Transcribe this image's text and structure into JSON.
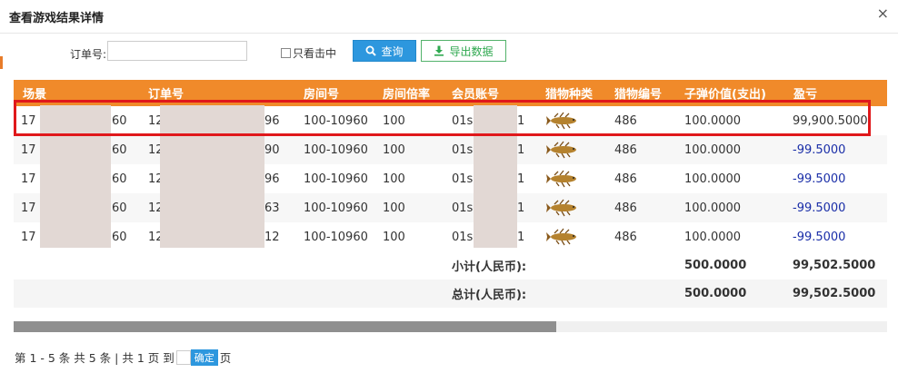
{
  "dialog": {
    "title": "查看游戏结果详情",
    "close": "×"
  },
  "toolbar": {
    "order_label": "订单号:",
    "order_value": "",
    "only_hit_label": "只看击中",
    "query_label": "查询",
    "export_label": "导出数据"
  },
  "table": {
    "headers": [
      "场景",
      "订单号",
      "房间号",
      "房间倍率",
      "会员账号",
      "猎物种类",
      "猎物编号",
      "子弹价值(支出)",
      "盈亏"
    ],
    "rows": [
      {
        "scene_a": "17",
        "scene_b": "60",
        "order_a": "12",
        "order_b": "96",
        "room": "100-10960",
        "rate": "100",
        "member_a": "01s",
        "member_b": "1",
        "prey_icon": "fish-icon",
        "prey_no": "486",
        "bullet": "100.0000",
        "profit": "99,900.5000"
      },
      {
        "scene_a": "17",
        "scene_b": "60",
        "order_a": "12",
        "order_b": "90",
        "room": "100-10960",
        "rate": "100",
        "member_a": "01s",
        "member_b": "1",
        "prey_icon": "fish-icon",
        "prey_no": "486",
        "bullet": "100.0000",
        "profit": "-99.5000"
      },
      {
        "scene_a": "17",
        "scene_b": "60",
        "order_a": "12",
        "order_b": "96",
        "room": "100-10960",
        "rate": "100",
        "member_a": "01s",
        "member_b": "1",
        "prey_icon": "fish-icon",
        "prey_no": "486",
        "bullet": "100.0000",
        "profit": "-99.5000"
      },
      {
        "scene_a": "17",
        "scene_b": "60",
        "order_a": "12",
        "order_b": "63",
        "room": "100-10960",
        "rate": "100",
        "member_a": "01s",
        "member_b": "1",
        "prey_icon": "fish-icon",
        "prey_no": "486",
        "bullet": "100.0000",
        "profit": "-99.5000"
      },
      {
        "scene_a": "17",
        "scene_b": "60",
        "order_a": "12",
        "order_b": "12",
        "room": "100-10960",
        "rate": "100",
        "member_a": "01s",
        "member_b": "1",
        "prey_icon": "fish-icon",
        "prey_no": "486",
        "bullet": "100.0000",
        "profit": "-99.5000"
      }
    ],
    "subtotal": {
      "label": "小计(人民币):",
      "bullet": "500.0000",
      "profit": "99,502.5000"
    },
    "total": {
      "label": "总计(人民币):",
      "bullet": "500.0000",
      "profit": "99,502.5000"
    }
  },
  "pager": {
    "summary": "第 1 - 5 条  共 5 条 |  共 1 页  到",
    "confirm": "确定",
    "page_unit": "页"
  },
  "colors": {
    "header": "#f08a2a",
    "highlight_border": "#e0181b",
    "query_button": "#2d97de",
    "export_button": "#2ea84f",
    "negative": "#1a2ea8"
  }
}
